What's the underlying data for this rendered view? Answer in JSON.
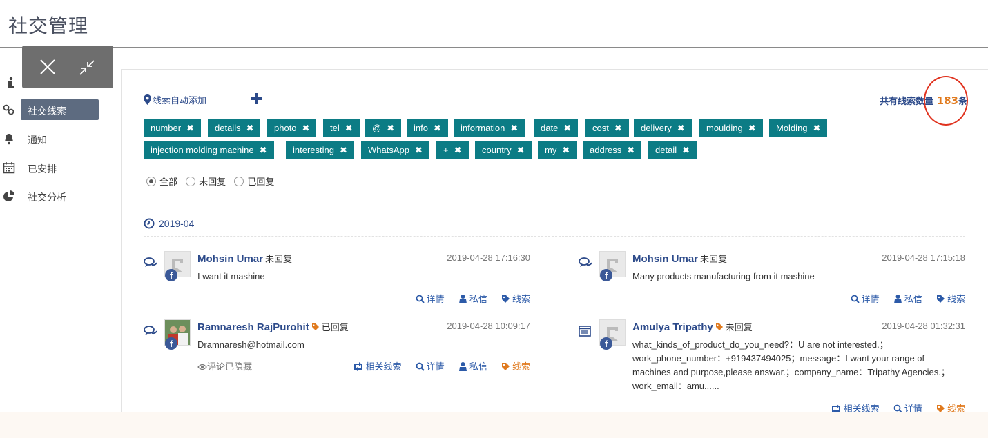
{
  "page": {
    "title": "社交管理"
  },
  "sidebar": {
    "items": [
      {
        "label": "",
        "icon": "info-icon"
      },
      {
        "label": "社交线索",
        "icon": "link-icon",
        "active": true
      },
      {
        "label": "通知",
        "icon": "bell-icon"
      },
      {
        "label": "已安排",
        "icon": "calendar-icon"
      },
      {
        "label": "社交分析",
        "icon": "pie-chart-icon"
      }
    ]
  },
  "toolbar": {
    "auto_add_label": "线索自动添加"
  },
  "total": {
    "prefix": "共有线索数量",
    "count": "183",
    "suffix": "条"
  },
  "tags": [
    "number",
    "details",
    "photo",
    "tel",
    "@",
    "info",
    "information",
    "date",
    "cost",
    "delivery",
    "moulding",
    "Molding",
    "injection molding machine",
    "interesting",
    "WhatsApp",
    "+",
    "country",
    "my",
    "address",
    "detail"
  ],
  "filters": {
    "all": "全部",
    "unreplied": "未回复",
    "replied": "已回复",
    "selected": "all"
  },
  "group": {
    "date": "2019-04"
  },
  "posts": [
    {
      "name": "Mohsin Umar",
      "status": "未回复",
      "time": "2019-04-28 17:16:30",
      "content": "I want it mashine",
      "actions": {
        "detail": "详情",
        "message": "私信",
        "lead": "线索"
      }
    },
    {
      "name": "Mohsin Umar",
      "status": "未回复",
      "time": "2019-04-28 17:15:18",
      "content": "Many products manufacturing from it mashine",
      "actions": {
        "detail": "详情",
        "message": "私信",
        "lead": "线索"
      }
    },
    {
      "name": "Ramnaresh RajPurohit",
      "status": "已回复",
      "time": "2019-04-28 10:09:17",
      "content": "Dramnaresh@hotmail.com",
      "hidden_note": "评论已隐藏",
      "actions": {
        "related": "相关线索",
        "detail": "详情",
        "message": "私信",
        "lead": "线索"
      }
    },
    {
      "name": "Amulya Tripathy",
      "status": "未回复",
      "time": "2019-04-28 01:32:31",
      "content": "what_kinds_of_product_do_you_need?：U are not interested.；work_phone_number：+919437494025；message：I want your range of machines and purpose,please answar.；company_name：Tripathy Agencies.；work_email：amu......",
      "actions": {
        "related": "相关线索",
        "detail": "详情",
        "lead": "线索"
      }
    }
  ],
  "colors": {
    "accent": "#0c7c85",
    "link": "#2c4a8a",
    "orange": "#e07a1e",
    "annotation": "#e0321e",
    "facebook": "#3b5998"
  }
}
